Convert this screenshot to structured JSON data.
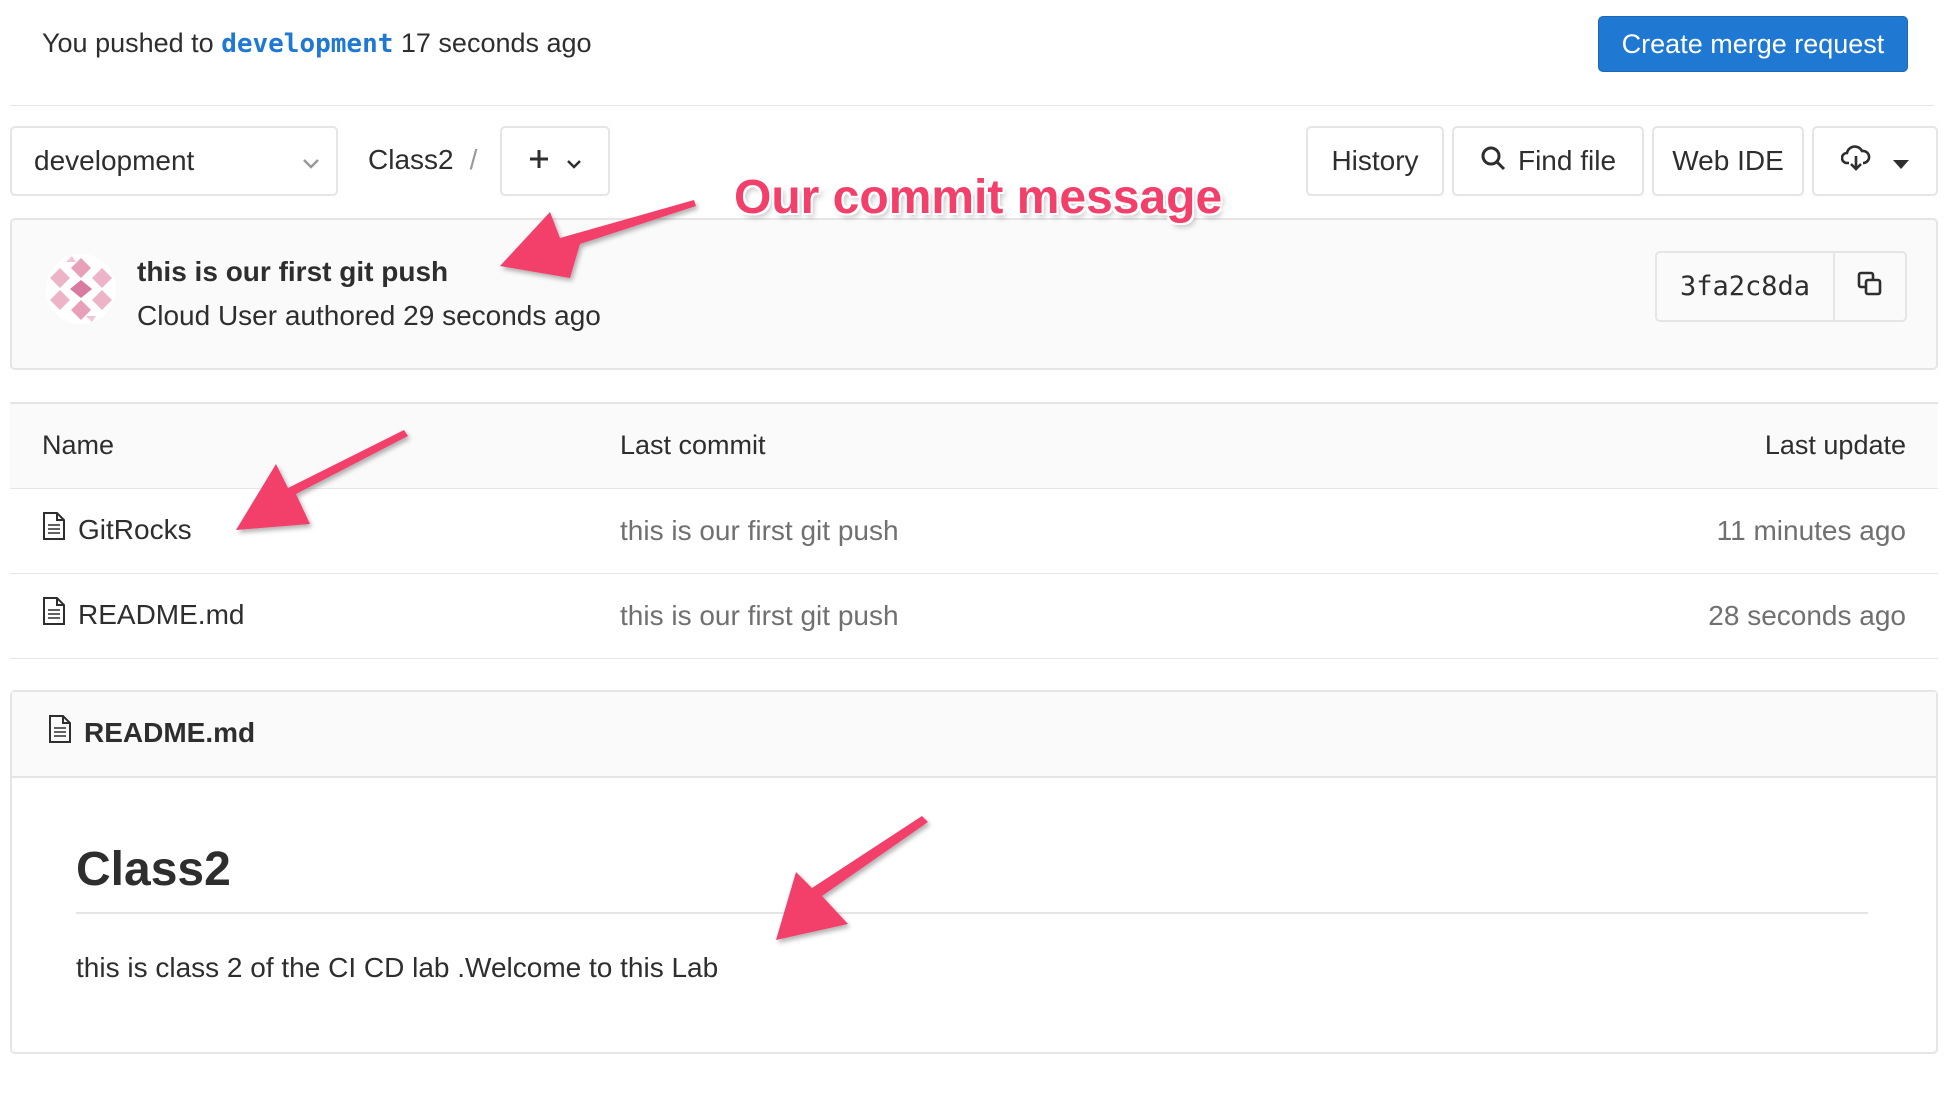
{
  "push_notice": {
    "prefix": "You pushed to",
    "branch": "development",
    "suffix": "17 seconds ago",
    "create_mr_label": "Create merge request"
  },
  "toolbar": {
    "branch": "development",
    "breadcrumb_project": "Class2",
    "breadcrumb_sep": "/",
    "add_icon": "plus-icon",
    "history_label": "History",
    "find_file_label": "Find file",
    "web_ide_label": "Web IDE",
    "download_icon": "cloud-download-icon"
  },
  "commit": {
    "title": "this is our first git push",
    "author": "Cloud User",
    "authored_text": "authored 29 seconds ago",
    "sha": "3fa2c8da"
  },
  "annotations": {
    "commit_message_label": "Our commit message",
    "color": "#f2406b"
  },
  "table": {
    "headers": {
      "name": "Name",
      "last_commit": "Last commit",
      "last_update": "Last update"
    },
    "rows": [
      {
        "name": "GitRocks",
        "last_commit": "this is our first git push",
        "last_update": "11 minutes ago"
      },
      {
        "name": "README.md",
        "last_commit": "this is our first git push",
        "last_update": "28 seconds ago"
      }
    ]
  },
  "readme": {
    "file_name": "README.md",
    "heading": "Class2",
    "body": "this is class 2 of the CI CD lab .Welcome to this Lab"
  },
  "colors": {
    "primary": "#1f78d1",
    "border": "#e5e5e5",
    "panel_bg": "#fafafa",
    "muted_text": "#707070"
  }
}
